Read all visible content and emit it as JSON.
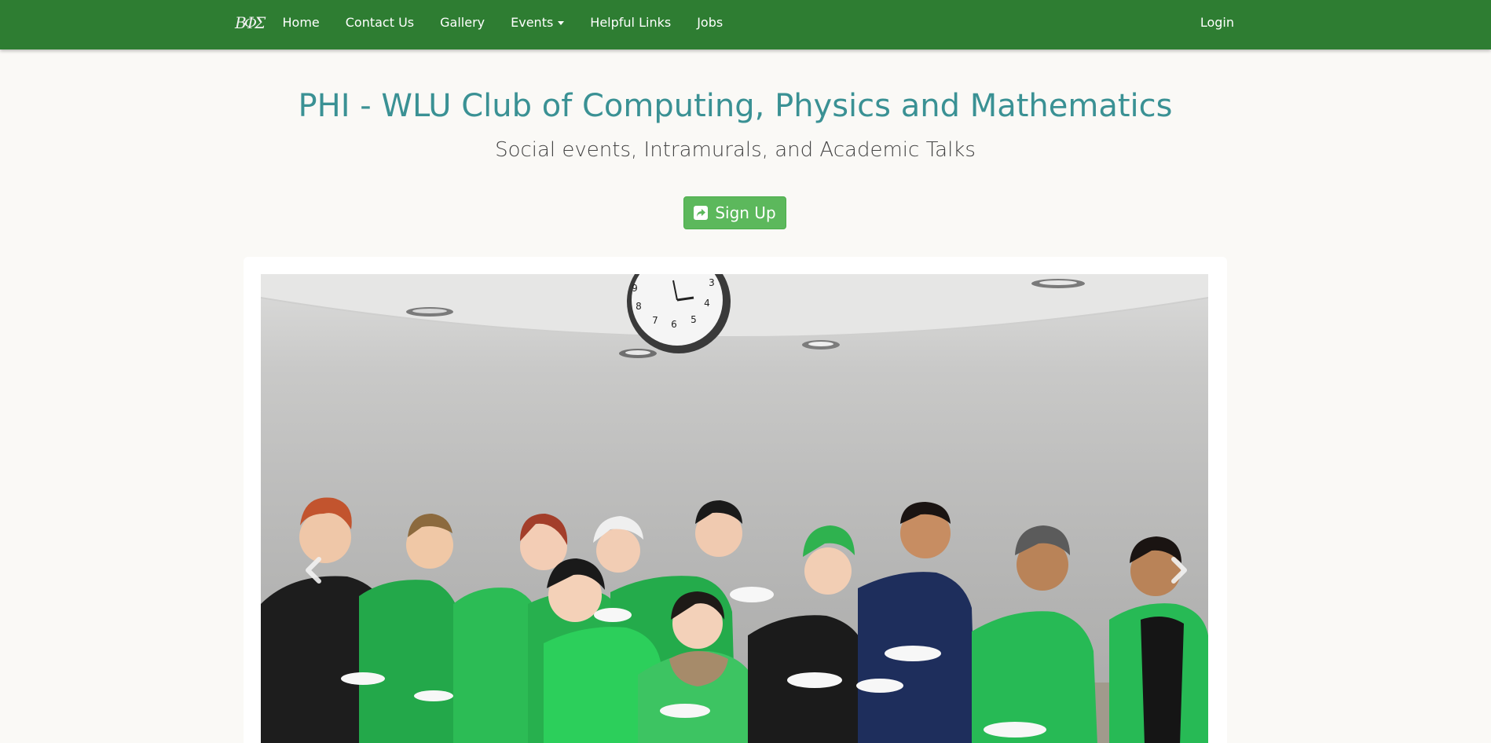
{
  "nav": {
    "brand": "BΦΣ",
    "links": [
      {
        "label": "Home"
      },
      {
        "label": "Contact Us"
      },
      {
        "label": "Gallery"
      },
      {
        "label": "Events",
        "dropdown": true
      },
      {
        "label": "Helpful Links"
      },
      {
        "label": "Jobs"
      }
    ],
    "login": "Login"
  },
  "hero": {
    "title": "PHI - WLU Club of Computing, Physics and Mathematics",
    "subtitle": "Social events, Intramurals, and Academic Talks",
    "signup_label": "Sign Up",
    "signup_icon": "share-square-icon"
  },
  "carousel": {
    "prev_icon": "chevron-left-icon",
    "next_icon": "chevron-right-icon",
    "clock_numbers": [
      "9",
      "3",
      "8",
      "4",
      "7",
      "6",
      "5"
    ]
  },
  "colors": {
    "navbar": "#2e7d32",
    "title": "#3a9194",
    "signup": "#5cb85c"
  }
}
